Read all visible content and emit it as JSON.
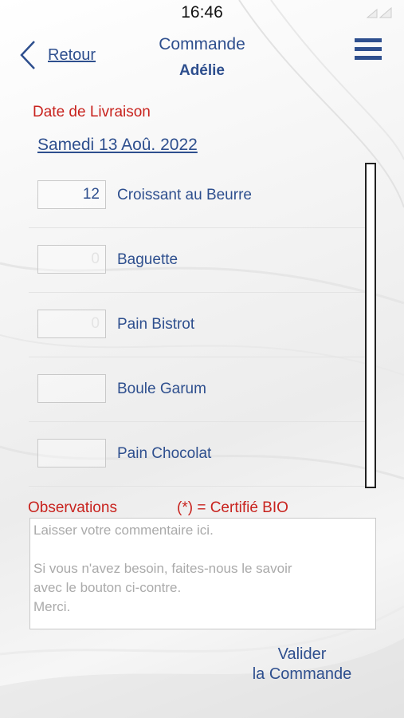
{
  "status_bar": {
    "time": "16:46"
  },
  "header": {
    "back_label": "Retour",
    "title": "Commande",
    "subtitle": "Adélie"
  },
  "delivery": {
    "label": "Date de Livraison",
    "date": "Samedi 13 Aoû. 2022"
  },
  "products": [
    {
      "name": "Croissant au Beurre",
      "qty": "12"
    },
    {
      "name": "Baguette",
      "qty": "0"
    },
    {
      "name": "Pain Bistrot",
      "qty": "0"
    },
    {
      "name": "Boule Garum",
      "qty": ""
    },
    {
      "name": "Pain Chocolat",
      "qty": ""
    }
  ],
  "observations": {
    "label": "Observations",
    "bio_note": "(*) = Certifié BIO",
    "placeholder_lines": [
      "Laisser votre commentaire ici.",
      "",
      "Si vous n'avez besoin, faites-nous le savoir",
      "avec le bouton ci-contre.",
      "Merci."
    ]
  },
  "submit": {
    "line1": "Valider",
    "line2": "la Commande"
  },
  "colors": {
    "accent_blue": "#2e4f8e",
    "label_red": "#c8231e"
  },
  "icons": {
    "back": "chevron-left-icon",
    "menu": "hamburger-menu-icon",
    "signal": "signal-icon"
  }
}
